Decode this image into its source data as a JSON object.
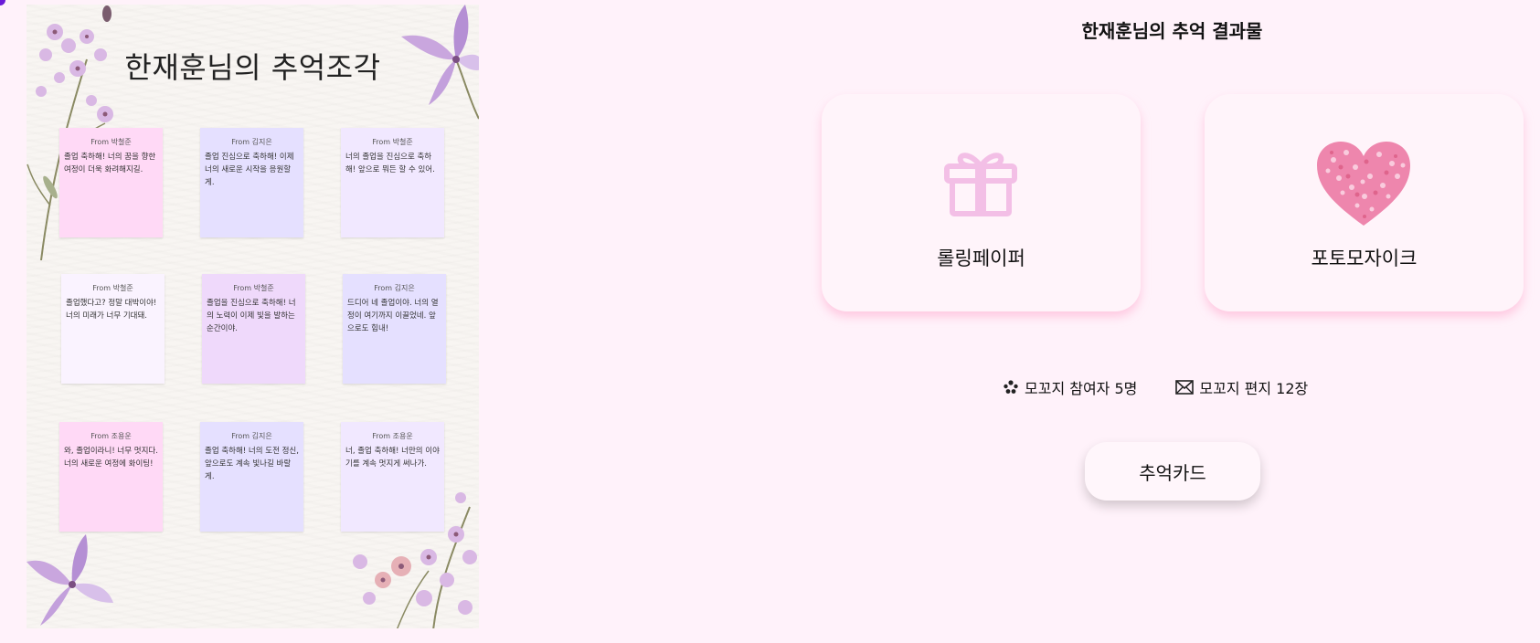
{
  "rolling_paper": {
    "title": "한재훈님의 추억조각",
    "notes": [
      {
        "from": "From 박철준",
        "text": "졸업 축하해! 너의 꿈을 향한 여정이 더욱 화려해지길.",
        "color": "#ffd9f6"
      },
      {
        "from": "From 김지은",
        "text": "졸업 진심으로 축하해! 이제 너의 새로운 시작을 응원할게.",
        "color": "#e5e0ff"
      },
      {
        "from": "From 박철준",
        "text": "너의 졸업을 진심으로 축하해! 앞으로 뭐든 할 수 있어.",
        "color": "#f1e8ff"
      },
      {
        "from": "From 박철준",
        "text": "졸업했다고? 정말 대박이야! 너의 미래가 너무 기대돼.",
        "color": "#faf3ff"
      },
      {
        "from": "From 박철준",
        "text": "졸업을 진심으로 축하해! 너의 노력이 이제 빛을 발하는 순간이야.",
        "color": "#efd9fb"
      },
      {
        "from": "From 김지은",
        "text": "드디어 네 졸업이야. 너의 열정이 여기까지 이끌었네. 앞으로도 힘내!",
        "color": "#e5e0ff"
      },
      {
        "from": "From 조용운",
        "text": "와, 졸업이라니! 너무 멋지다. 너의 새로운 여정에 화이팅!",
        "color": "#ffd9f6"
      },
      {
        "from": "From 김지은",
        "text": "졸업 축하해! 너의 도전 정신, 앞으로도 계속 빛나길 바랄게.",
        "color": "#e5e0ff"
      },
      {
        "from": "From 조용운",
        "text": "너, 졸업 축하해! 너만의 이야기를 계속 멋지게 써나가.",
        "color": "#f1e8ff"
      }
    ]
  },
  "result": {
    "title": "한재훈님의 추억 결과물",
    "cards": [
      {
        "label": "롤링페이퍼",
        "icon": "gift-icon"
      },
      {
        "label": "포토모자이크",
        "icon": "heart-mosaic-icon"
      }
    ],
    "participants_label": "모꼬지 참여자 5명",
    "letters_label": "모꼬지 편지 12장",
    "memory_card_button": "추억카드"
  },
  "colors": {
    "background": "#fff2fa",
    "card_shadow": "#ffaacd",
    "gift": "#f3bfe6",
    "heart": "#ee86ad"
  }
}
